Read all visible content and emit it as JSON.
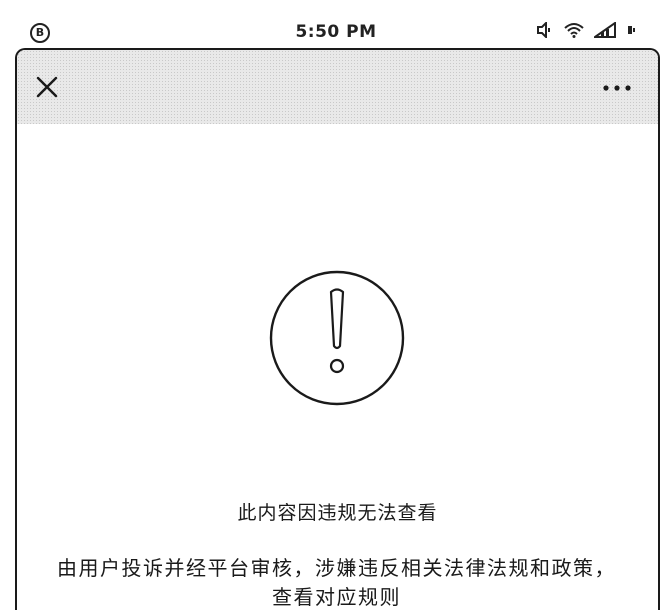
{
  "status_bar": {
    "left_icon_glyph": "B",
    "time": "5:50 PM",
    "icons": [
      "mute-icon",
      "wifi-icon",
      "signal-icon",
      "battery-icon"
    ]
  },
  "navbar": {
    "close_icon": "close-icon",
    "more_icon": "more-icon"
  },
  "notice": {
    "icon": "exclamation-icon",
    "title": "此内容因违规无法查看",
    "description": "由用户投诉并经平台审核，涉嫌违反相关法律法规和政策，查看对应规则"
  },
  "colors": {
    "navbar_bg": "#e9e9e9",
    "text": "#1a1a1a",
    "icon": "#222222"
  }
}
